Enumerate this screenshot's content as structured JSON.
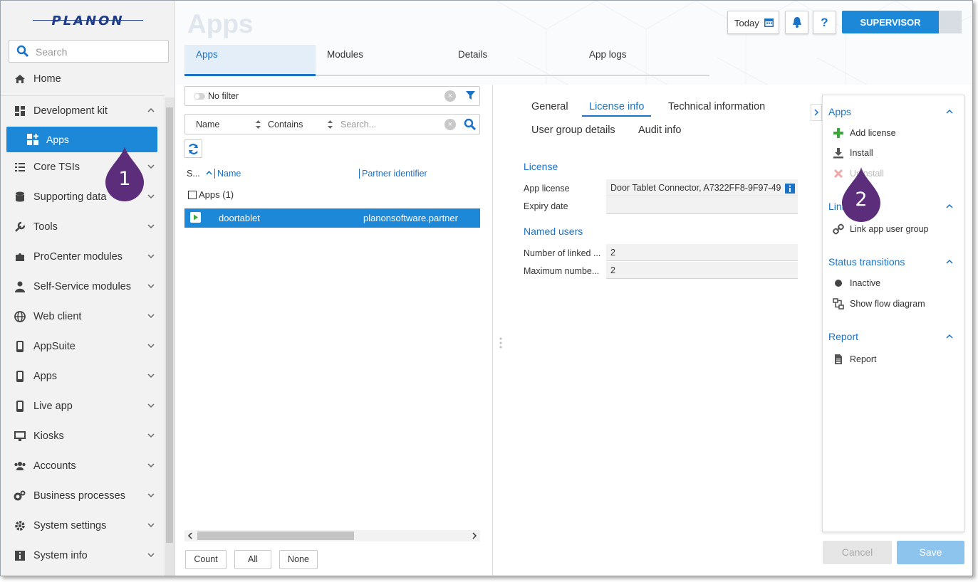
{
  "brand": {
    "logo_text": "PLANON"
  },
  "sidebar": {
    "search_placeholder": "Search",
    "home": "Home",
    "items": [
      {
        "label": "Development kit",
        "icon": "dashboard-icon",
        "expanded": true
      },
      {
        "label": "Core TSIs",
        "icon": "list-icon"
      },
      {
        "label": "Supporting data",
        "icon": "database-icon"
      },
      {
        "label": "Tools",
        "icon": "wrench-icon"
      },
      {
        "label": "ProCenter modules",
        "icon": "puzzle-icon"
      },
      {
        "label": "Self-Service modules",
        "icon": "user-icon"
      },
      {
        "label": "Web client",
        "icon": "globe-icon"
      },
      {
        "label": "AppSuite",
        "icon": "mobile-icon"
      },
      {
        "label": "Apps",
        "icon": "mobile-icon"
      },
      {
        "label": "Live app",
        "icon": "mobile-icon"
      },
      {
        "label": "Kiosks",
        "icon": "monitor-icon"
      },
      {
        "label": "Accounts",
        "icon": "users-icon"
      },
      {
        "label": "Business processes",
        "icon": "cogs-icon"
      },
      {
        "label": "System settings",
        "icon": "gear-icon"
      },
      {
        "label": "System info",
        "icon": "info-icon"
      }
    ],
    "active_subitem": "Apps"
  },
  "header": {
    "title": "Apps",
    "today_label": "Today",
    "help_label": "?",
    "user_label": "SUPERVISOR"
  },
  "tabs": [
    "Apps",
    "Modules",
    "Details",
    "App logs"
  ],
  "list": {
    "filter_label": "No filter",
    "search_field": "Name",
    "search_operator": "Contains",
    "search_placeholder": "Search...",
    "columns": [
      "S...",
      "Name",
      "Partner identifier"
    ],
    "group_label": "Apps (1)",
    "rows": [
      {
        "name": "doortablet",
        "partner": "planonsoftware.partner"
      }
    ],
    "buttons": {
      "count": "Count",
      "all": "All",
      "none": "None"
    }
  },
  "details": {
    "tabs": [
      "General",
      "License info",
      "Technical information",
      "User group details",
      "Audit info"
    ],
    "active_tab": "License info",
    "license": {
      "section": "License",
      "app_license_label": "App license",
      "app_license_value": "Door Tablet Connector, A7322FF8-9F97-49",
      "expiry_label": "Expiry date",
      "expiry_value": ""
    },
    "named_users": {
      "section": "Named users",
      "linked_label": "Number of linked ...",
      "linked_value": "2",
      "max_label": "Maximum numbe...",
      "max_value": "2"
    }
  },
  "actions": {
    "apps_title": "Apps",
    "add_license": "Add license",
    "install": "Install",
    "uninstall": "Uninstall",
    "link_title": "Link",
    "link_user_group": "Link app user group",
    "status_title": "Status transitions",
    "inactive": "Inactive",
    "show_flow": "Show flow diagram",
    "report_title": "Report",
    "report": "Report"
  },
  "footer": {
    "cancel": "Cancel",
    "save": "Save"
  },
  "callouts": [
    "1",
    "2"
  ],
  "colors": {
    "accent": "#1e88d8",
    "callout": "#5b2d7a",
    "link": "#1a73c6"
  }
}
